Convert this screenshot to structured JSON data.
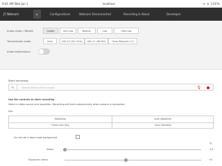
{
  "statusbar": {
    "left": "9:41 AM  Wed Jan 1",
    "center": "localhost",
    "right": "◔ ◔ 100%"
  },
  "navbar": {
    "brand": "JT Webcam",
    "tabs": [
      "⌂",
      "Configurations",
      "Webcam Disconnected",
      "Recording & About",
      "Developer"
    ]
  },
  "settings": {
    "row1_label": "Audio codec / Bitrate",
    "row1_options": [
      "Quality",
      "Very Low",
      "Medium",
      "Low",
      "Ultra Low"
    ],
    "row2_label": "Transmission audio",
    "row2_options": [
      "Auto",
      "AAC-LC (44.1 kHz)",
      "AAC-LC (48 kHz)",
      "Opus (Requires 1.2)"
    ],
    "row3_label": "Audio bidirectional"
  },
  "recording": {
    "label": "Start recording",
    "placeholder": "Choose folder or file to record",
    "file_icon": "✎",
    "mic_icon": "🎙"
  },
  "info": {
    "heading": "Use the controls to start recording",
    "description": "Select a video source and resolution. Recording will start automatically when camera is connected.",
    "table_label": "Info"
  },
  "table": {
    "rows": [
      [
        "Resolution",
        "Auto (Adaptive)"
      ],
      [
        "Frame rate (fps)",
        "Auto (Variable)"
      ]
    ]
  },
  "options": {
    "checkbox_label": "Do not use a dark mode background"
  },
  "sliders": {
    "zoom": {
      "label": "Zoom",
      "value": "1.0",
      "fraction": 0.0
    },
    "exposure": {
      "label": "Exposure comp",
      "value": "+0",
      "fraction": 0.45
    }
  }
}
